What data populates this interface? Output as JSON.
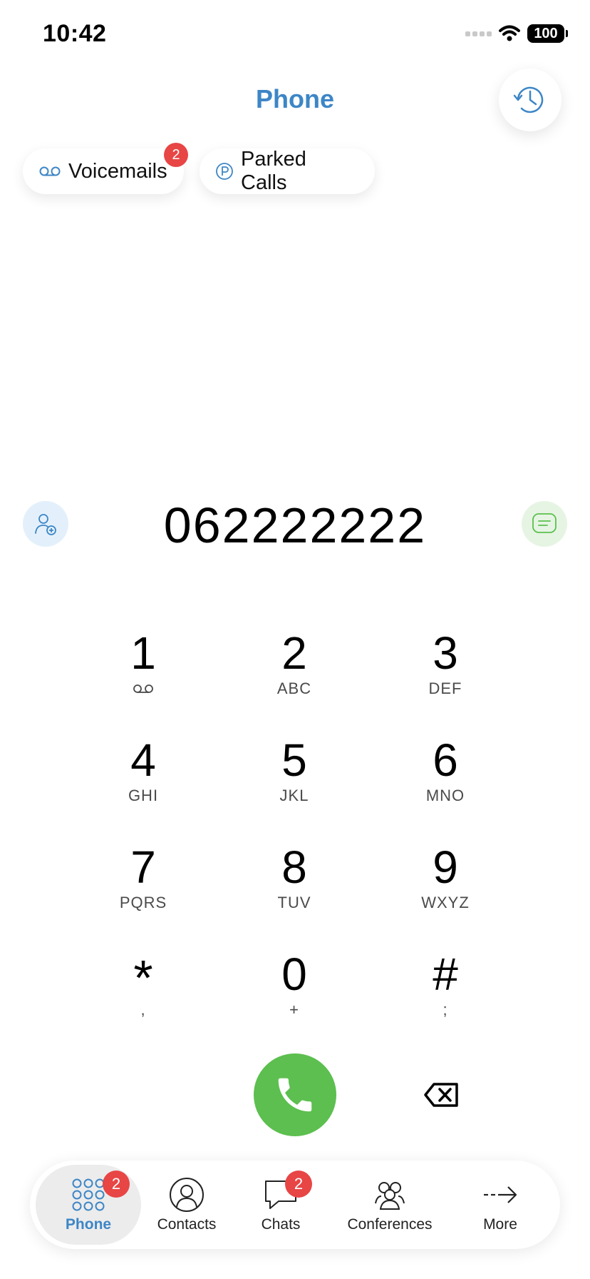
{
  "status_bar": {
    "time": "10:42",
    "battery": "100"
  },
  "header": {
    "title": "Phone"
  },
  "chips": {
    "voicemails": {
      "label": "Voicemails",
      "badge": "2"
    },
    "parked_calls": {
      "label": "Parked Calls"
    }
  },
  "dialer": {
    "number": "062222222"
  },
  "keypad": {
    "keys": [
      {
        "digit": "1",
        "letters": ""
      },
      {
        "digit": "2",
        "letters": "ABC"
      },
      {
        "digit": "3",
        "letters": "DEF"
      },
      {
        "digit": "4",
        "letters": "GHI"
      },
      {
        "digit": "5",
        "letters": "JKL"
      },
      {
        "digit": "6",
        "letters": "MNO"
      },
      {
        "digit": "7",
        "letters": "PQRS"
      },
      {
        "digit": "8",
        "letters": "TUV"
      },
      {
        "digit": "9",
        "letters": "WXYZ"
      },
      {
        "digit": "*",
        "letters": ","
      },
      {
        "digit": "0",
        "letters": "+"
      },
      {
        "digit": "#",
        "letters": ";"
      }
    ]
  },
  "tabs": [
    {
      "label": "Phone",
      "badge": "2",
      "icon": "keypad-icon",
      "active": true
    },
    {
      "label": "Contacts",
      "icon": "contact-icon"
    },
    {
      "label": "Chats",
      "badge": "2",
      "icon": "chat-bubble-icon"
    },
    {
      "label": "Conferences",
      "icon": "group-icon"
    },
    {
      "label": "More",
      "icon": "arrow-right-icon"
    }
  ],
  "colors": {
    "accent_blue": "#3d86c6",
    "call_green": "#5cbf4f",
    "badge_red": "#e84545",
    "add_contact_bg": "#e3f0fb",
    "message_bg": "#e6f5e3"
  }
}
